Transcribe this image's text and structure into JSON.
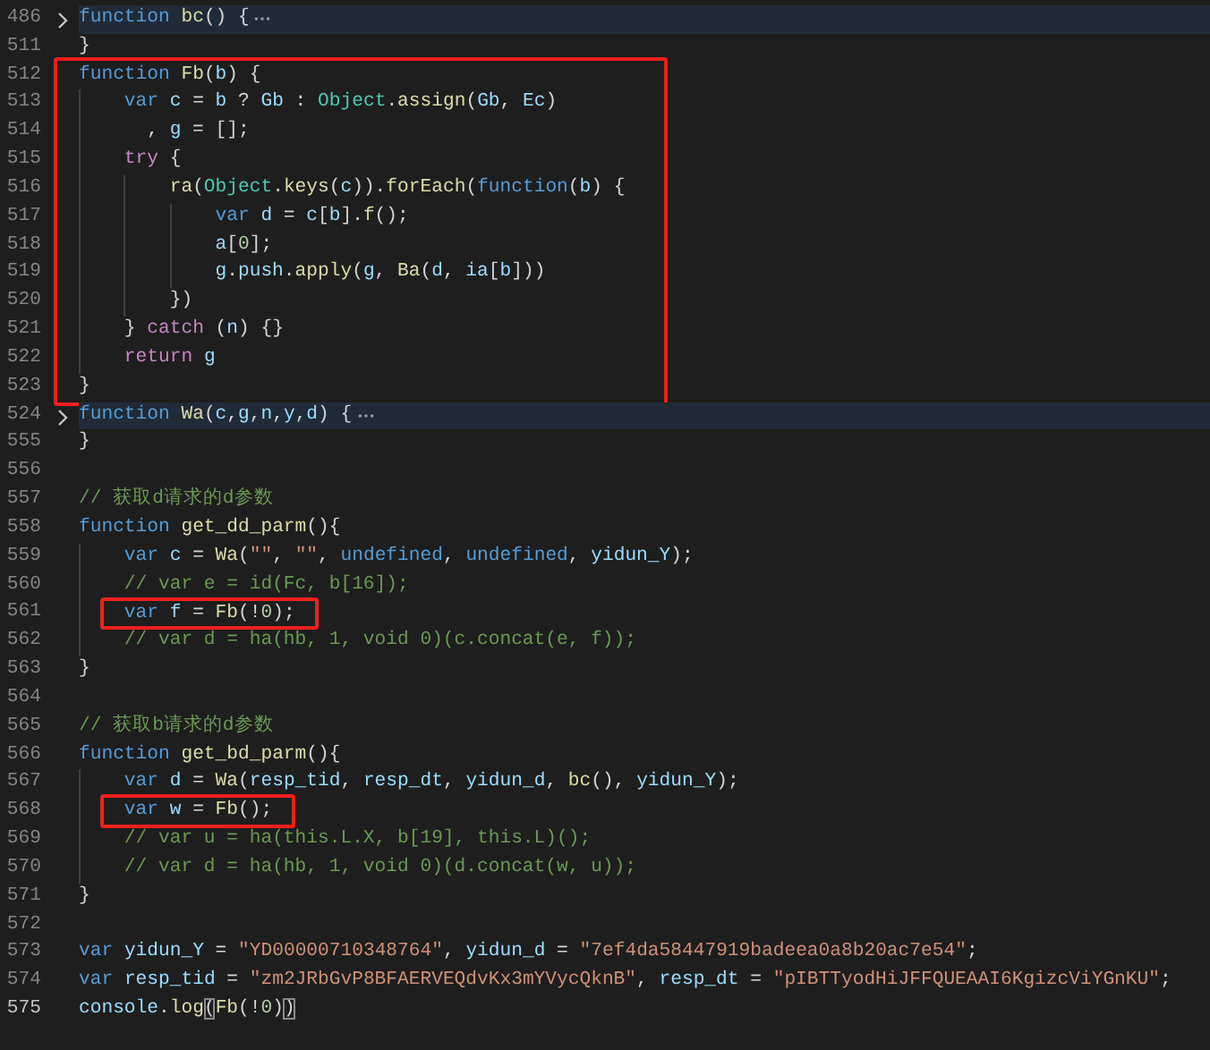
{
  "lines": [
    {
      "kind": "line",
      "number": "486",
      "folded": true,
      "current": false,
      "tokens": [
        {
          "kind": "kw",
          "text": "function "
        },
        {
          "kind": "fn",
          "text": "bc"
        },
        {
          "kind": "pun",
          "text": "() {"
        }
      ]
    },
    {
      "kind": "line",
      "number": "511",
      "folded": false,
      "current": false,
      "tokens": [
        {
          "kind": "pun",
          "text": "}"
        }
      ]
    },
    {
      "kind": "box_group",
      "lines": [
        {
          "kind": "line",
          "number": "512",
          "folded": false,
          "current": false,
          "tokens": [
            {
              "kind": "kw",
              "text": "function "
            },
            {
              "kind": "fn",
              "text": "Fb"
            },
            {
              "kind": "pun",
              "text": "("
            },
            {
              "kind": "var",
              "text": "b"
            },
            {
              "kind": "pun",
              "text": ") {"
            }
          ]
        },
        {
          "kind": "line",
          "number": "513",
          "folded": false,
          "current": false,
          "tokens": [
            {
              "kind": "kw",
              "text": "    var "
            },
            {
              "kind": "var",
              "text": "c"
            },
            {
              "kind": "pun",
              "text": " = "
            },
            {
              "kind": "var",
              "text": "b"
            },
            {
              "kind": "pun",
              "text": " ? "
            },
            {
              "kind": "var",
              "text": "Gb"
            },
            {
              "kind": "pun",
              "text": " : "
            },
            {
              "kind": "cls",
              "text": "Object"
            },
            {
              "kind": "pun",
              "text": "."
            },
            {
              "kind": "fn",
              "text": "assign"
            },
            {
              "kind": "pun",
              "text": "("
            },
            {
              "kind": "var",
              "text": "Gb"
            },
            {
              "kind": "pun",
              "text": ", "
            },
            {
              "kind": "var",
              "text": "Ec"
            },
            {
              "kind": "pun",
              "text": ")"
            }
          ]
        },
        {
          "kind": "line",
          "number": "514",
          "folded": false,
          "current": false,
          "tokens": [
            {
              "kind": "pun",
              "text": "      , "
            },
            {
              "kind": "var",
              "text": "g"
            },
            {
              "kind": "pun",
              "text": " = [];"
            }
          ]
        },
        {
          "kind": "line",
          "number": "515",
          "folded": false,
          "current": false,
          "tokens": [
            {
              "kind": "ctl",
              "text": "    try"
            },
            {
              "kind": "pun",
              "text": " {"
            }
          ]
        },
        {
          "kind": "line",
          "number": "516",
          "folded": false,
          "current": false,
          "tokens": [
            {
              "kind": "fn",
              "text": "        ra"
            },
            {
              "kind": "pun",
              "text": "("
            },
            {
              "kind": "cls",
              "text": "Object"
            },
            {
              "kind": "pun",
              "text": "."
            },
            {
              "kind": "fn",
              "text": "keys"
            },
            {
              "kind": "pun",
              "text": "("
            },
            {
              "kind": "var",
              "text": "c"
            },
            {
              "kind": "pun",
              "text": "))."
            },
            {
              "kind": "fn",
              "text": "forEach"
            },
            {
              "kind": "pun",
              "text": "("
            },
            {
              "kind": "kw",
              "text": "function"
            },
            {
              "kind": "pun",
              "text": "("
            },
            {
              "kind": "var",
              "text": "b"
            },
            {
              "kind": "pun",
              "text": ") {"
            }
          ]
        },
        {
          "kind": "line",
          "number": "517",
          "folded": false,
          "current": false,
          "tokens": [
            {
              "kind": "kw",
              "text": "            var "
            },
            {
              "kind": "var",
              "text": "d"
            },
            {
              "kind": "pun",
              "text": " = "
            },
            {
              "kind": "var",
              "text": "c"
            },
            {
              "kind": "pun",
              "text": "["
            },
            {
              "kind": "var",
              "text": "b"
            },
            {
              "kind": "pun",
              "text": "]."
            },
            {
              "kind": "fn",
              "text": "f"
            },
            {
              "kind": "pun",
              "text": "();"
            }
          ]
        },
        {
          "kind": "line",
          "number": "518",
          "folded": false,
          "current": false,
          "tokens": [
            {
              "kind": "var",
              "text": "            a"
            },
            {
              "kind": "pun",
              "text": "["
            },
            {
              "kind": "num",
              "text": "0"
            },
            {
              "kind": "pun",
              "text": "];"
            }
          ]
        },
        {
          "kind": "line",
          "number": "519",
          "folded": false,
          "current": false,
          "tokens": [
            {
              "kind": "var",
              "text": "            g"
            },
            {
              "kind": "pun",
              "text": "."
            },
            {
              "kind": "var",
              "text": "push"
            },
            {
              "kind": "pun",
              "text": "."
            },
            {
              "kind": "fn",
              "text": "apply"
            },
            {
              "kind": "pun",
              "text": "("
            },
            {
              "kind": "var",
              "text": "g"
            },
            {
              "kind": "pun",
              "text": ", "
            },
            {
              "kind": "fn",
              "text": "Ba"
            },
            {
              "kind": "pun",
              "text": "("
            },
            {
              "kind": "var",
              "text": "d"
            },
            {
              "kind": "pun",
              "text": ", "
            },
            {
              "kind": "var",
              "text": "ia"
            },
            {
              "kind": "pun",
              "text": "["
            },
            {
              "kind": "var",
              "text": "b"
            },
            {
              "kind": "pun",
              "text": "]))"
            }
          ]
        },
        {
          "kind": "line",
          "number": "520",
          "folded": false,
          "current": false,
          "tokens": [
            {
              "kind": "pun",
              "text": "        })"
            }
          ]
        },
        {
          "kind": "line",
          "number": "521",
          "folded": false,
          "current": false,
          "tokens": [
            {
              "kind": "pun",
              "text": "    } "
            },
            {
              "kind": "ctl",
              "text": "catch"
            },
            {
              "kind": "pun",
              "text": " ("
            },
            {
              "kind": "var",
              "text": "n"
            },
            {
              "kind": "pun",
              "text": ") {}"
            }
          ]
        },
        {
          "kind": "line",
          "number": "522",
          "folded": false,
          "current": false,
          "tokens": [
            {
              "kind": "ctl",
              "text": "    return "
            },
            {
              "kind": "var",
              "text": "g"
            }
          ]
        },
        {
          "kind": "line",
          "number": "523",
          "folded": false,
          "current": false,
          "tokens": [
            {
              "kind": "pun",
              "text": "}"
            }
          ]
        }
      ]
    },
    {
      "kind": "line",
      "number": "524",
      "folded": true,
      "current": false,
      "tokens": [
        {
          "kind": "kw",
          "text": "function "
        },
        {
          "kind": "fn",
          "text": "Wa"
        },
        {
          "kind": "pun",
          "text": "("
        },
        {
          "kind": "var",
          "text": "c"
        },
        {
          "kind": "pun",
          "text": ","
        },
        {
          "kind": "var",
          "text": "g"
        },
        {
          "kind": "pun",
          "text": ","
        },
        {
          "kind": "var",
          "text": "n"
        },
        {
          "kind": "pun",
          "text": ","
        },
        {
          "kind": "var",
          "text": "y"
        },
        {
          "kind": "pun",
          "text": ","
        },
        {
          "kind": "var",
          "text": "d"
        },
        {
          "kind": "pun",
          "text": ") {"
        }
      ]
    },
    {
      "kind": "line",
      "number": "555",
      "folded": false,
      "current": false,
      "tokens": [
        {
          "kind": "pun",
          "text": "}"
        }
      ]
    },
    {
      "kind": "line",
      "number": "556",
      "folded": false,
      "current": false
    },
    {
      "kind": "line",
      "number": "557",
      "folded": false,
      "current": false,
      "tokens": [
        {
          "kind": "com",
          "text": "// 获取d请求的d参数"
        }
      ]
    },
    {
      "kind": "line",
      "number": "558",
      "folded": false,
      "current": false,
      "tokens": [
        {
          "kind": "kw",
          "text": "function "
        },
        {
          "kind": "fn",
          "text": "get_dd_parm"
        },
        {
          "kind": "pun",
          "text": "(){"
        }
      ]
    },
    {
      "kind": "line",
      "number": "559",
      "folded": false,
      "current": false,
      "tokens": [
        {
          "kind": "kw",
          "text": "    var "
        },
        {
          "kind": "var",
          "text": "c"
        },
        {
          "kind": "pun",
          "text": " = "
        },
        {
          "kind": "fn",
          "text": "Wa"
        },
        {
          "kind": "pun",
          "text": "("
        },
        {
          "kind": "str",
          "text": "\"\""
        },
        {
          "kind": "pun",
          "text": ", "
        },
        {
          "kind": "str",
          "text": "\"\""
        },
        {
          "kind": "pun",
          "text": ", "
        },
        {
          "kind": "kw",
          "text": "undefined"
        },
        {
          "kind": "pun",
          "text": ", "
        },
        {
          "kind": "kw",
          "text": "undefined"
        },
        {
          "kind": "pun",
          "text": ", "
        },
        {
          "kind": "var",
          "text": "yidun_Y"
        },
        {
          "kind": "pun",
          "text": ");"
        }
      ]
    },
    {
      "kind": "line",
      "number": "560",
      "folded": false,
      "current": false,
      "tokens": [
        {
          "kind": "com",
          "text": "    // var e = id(Fc, b[16]);"
        }
      ]
    },
    {
      "kind": "boxed_line",
      "number": "561",
      "folded": false,
      "current": false,
      "tokens": [
        {
          "kind": "kw",
          "text": "    var "
        },
        {
          "kind": "var",
          "text": "f"
        },
        {
          "kind": "pun",
          "text": " = "
        },
        {
          "kind": "fn",
          "text": "Fb"
        },
        {
          "kind": "pun",
          "text": "(!"
        },
        {
          "kind": "num",
          "text": "0"
        },
        {
          "kind": "pun",
          "text": ");"
        }
      ]
    },
    {
      "kind": "line",
      "number": "562",
      "folded": false,
      "current": false,
      "tokens": [
        {
          "kind": "com",
          "text": "    // var d = ha(hb, 1, void 0)(c.concat(e, f));"
        }
      ]
    },
    {
      "kind": "line",
      "number": "563",
      "folded": false,
      "current": false,
      "tokens": [
        {
          "kind": "pun",
          "text": "}"
        }
      ]
    },
    {
      "kind": "line",
      "number": "564",
      "folded": false,
      "current": false
    },
    {
      "kind": "line",
      "number": "565",
      "folded": false,
      "current": false,
      "tokens": [
        {
          "kind": "com",
          "text": "// 获取b请求的d参数"
        }
      ]
    },
    {
      "kind": "line",
      "number": "566",
      "folded": false,
      "current": false,
      "tokens": [
        {
          "kind": "kw",
          "text": "function "
        },
        {
          "kind": "fn",
          "text": "get_bd_parm"
        },
        {
          "kind": "pun",
          "text": "(){"
        }
      ]
    },
    {
      "kind": "line",
      "number": "567",
      "folded": false,
      "current": false,
      "tokens": [
        {
          "kind": "kw",
          "text": "    var "
        },
        {
          "kind": "var",
          "text": "d"
        },
        {
          "kind": "pun",
          "text": " = "
        },
        {
          "kind": "fn",
          "text": "Wa"
        },
        {
          "kind": "pun",
          "text": "("
        },
        {
          "kind": "var",
          "text": "resp_tid"
        },
        {
          "kind": "pun",
          "text": ", "
        },
        {
          "kind": "var",
          "text": "resp_dt"
        },
        {
          "kind": "pun",
          "text": ", "
        },
        {
          "kind": "var",
          "text": "yidun_d"
        },
        {
          "kind": "pun",
          "text": ", "
        },
        {
          "kind": "fn",
          "text": "bc"
        },
        {
          "kind": "pun",
          "text": "(), "
        },
        {
          "kind": "var",
          "text": "yidun_Y"
        },
        {
          "kind": "pun",
          "text": ");"
        }
      ]
    },
    {
      "kind": "boxed_line",
      "number": "568",
      "folded": false,
      "current": false,
      "tokens": [
        {
          "kind": "kw",
          "text": "    var "
        },
        {
          "kind": "var",
          "text": "w"
        },
        {
          "kind": "pun",
          "text": " = "
        },
        {
          "kind": "fn",
          "text": "Fb"
        },
        {
          "kind": "pun",
          "text": "();"
        }
      ]
    },
    {
      "kind": "line",
      "number": "569",
      "folded": false,
      "current": false,
      "tokens": [
        {
          "kind": "com",
          "text": "    // var u = ha(this.L.X, b[19], this.L)();"
        }
      ]
    },
    {
      "kind": "line",
      "number": "570",
      "folded": false,
      "current": false,
      "tokens": [
        {
          "kind": "com",
          "text": "    // var d = ha(hb, 1, void 0)(d.concat(w, u));"
        }
      ]
    },
    {
      "kind": "line",
      "number": "571",
      "folded": false,
      "current": false,
      "tokens": [
        {
          "kind": "pun",
          "text": "}"
        }
      ]
    },
    {
      "kind": "line",
      "number": "572",
      "folded": false,
      "current": false
    },
    {
      "kind": "line",
      "number": "573",
      "folded": false,
      "current": false,
      "tokens": [
        {
          "kind": "kw",
          "text": "var "
        },
        {
          "kind": "var",
          "text": "yidun_Y"
        },
        {
          "kind": "pun",
          "text": " = "
        },
        {
          "kind": "str",
          "text": "\"YD00000710348764\""
        },
        {
          "kind": "pun",
          "text": ", "
        },
        {
          "kind": "var",
          "text": "yidun_d"
        },
        {
          "kind": "pun",
          "text": " = "
        },
        {
          "kind": "str",
          "text": "\"7ef4da58447919badeea0a8b20ac7e54\""
        },
        {
          "kind": "pun",
          "text": ";"
        }
      ]
    },
    {
      "kind": "line",
      "number": "574",
      "folded": false,
      "current": false,
      "tokens": [
        {
          "kind": "kw",
          "text": "var "
        },
        {
          "kind": "var",
          "text": "resp_tid"
        },
        {
          "kind": "pun",
          "text": " = "
        },
        {
          "kind": "str",
          "text": "\"zm2JRbGvP8BFAERVEQdvKx3mYVycQknB\""
        },
        {
          "kind": "pun",
          "text": ", "
        },
        {
          "kind": "var",
          "text": "resp_dt"
        },
        {
          "kind": "pun",
          "text": " = "
        },
        {
          "kind": "str",
          "text": "\"pIBTTyodHiJFFQUEAAI6KgizcViYGnKU\""
        },
        {
          "kind": "pun",
          "text": ";"
        }
      ]
    },
    {
      "kind": "line",
      "number": "575",
      "folded": false,
      "current": true,
      "tokens": [
        {
          "kind": "var",
          "text": "console"
        },
        {
          "kind": "pun",
          "text": "."
        },
        {
          "kind": "fn",
          "text": "log"
        },
        {
          "kind": "match",
          "text": "("
        },
        {
          "kind": "fn",
          "text": "Fb"
        },
        {
          "kind": "pun",
          "text": "(!"
        },
        {
          "kind": "num",
          "text": "0"
        },
        {
          "kind": "pun",
          "text": ")"
        },
        {
          "kind": "match",
          "text": ")"
        }
      ]
    }
  ]
}
